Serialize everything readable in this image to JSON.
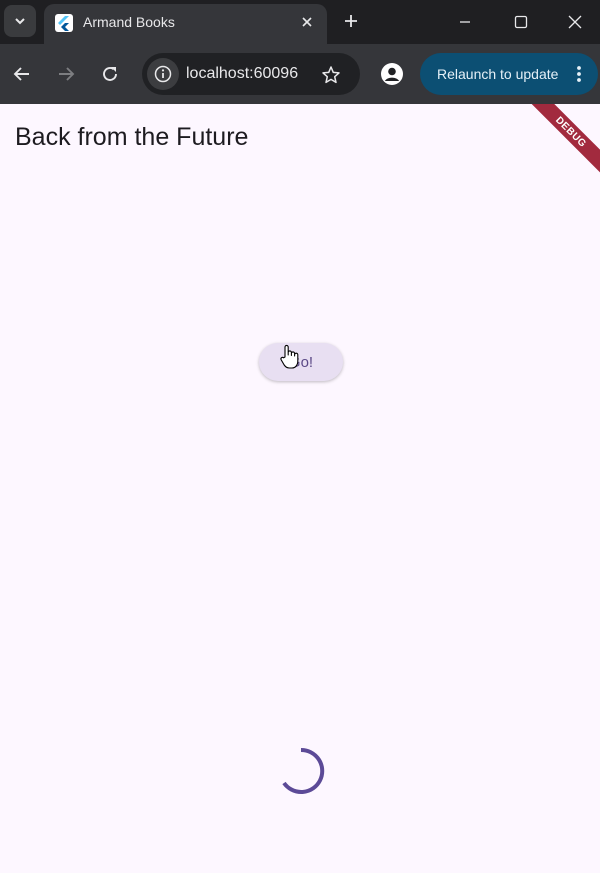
{
  "browser": {
    "tab": {
      "title": "Armand Books"
    },
    "url": "localhost:60096",
    "relaunch_label": "Relaunch to update"
  },
  "app": {
    "title": "Back from the Future",
    "debug_banner": "DEBUG",
    "go_button_label": "Go!",
    "colors": {
      "background": "#fdf7ff",
      "accent": "#5c4a87",
      "banner": "#a22a3e"
    }
  }
}
